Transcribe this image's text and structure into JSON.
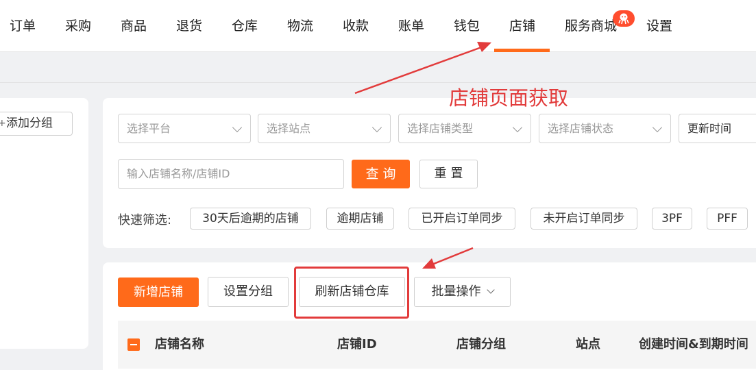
{
  "nav": {
    "items": [
      "订单",
      "采购",
      "商品",
      "退货",
      "仓库",
      "物流",
      "收款",
      "账单",
      "钱包",
      "店铺",
      "服务商城",
      "设置"
    ],
    "active": "店铺",
    "badge_icon": "octopus-icon"
  },
  "sidebar": {
    "add_group": "添加分组",
    "add_icon": "plus-icon"
  },
  "filters": {
    "platform_placeholder": "选择平台",
    "site_placeholder": "选择站点",
    "store_type_placeholder": "选择店铺类型",
    "store_status_placeholder": "选择店铺状态",
    "sort_label": "更新时间",
    "search_placeholder": "输入店铺名称/店铺ID",
    "query_button": "查询",
    "reset_button": "重置",
    "quick_label": "快速筛选:",
    "chips": [
      "30天后逾期的店铺",
      "逾期店铺",
      "已开启订单同步",
      "未开启订单同步",
      "3PF",
      "PFF"
    ]
  },
  "toolbar": {
    "new_store": "新增店铺",
    "set_group": "设置分组",
    "refresh_warehouse": "刷新店铺仓库",
    "batch_ops": "批量操作"
  },
  "table": {
    "headers": [
      "店铺名称",
      "店铺ID",
      "店铺分组",
      "站点",
      "创建时间&到期时间"
    ]
  },
  "annotation": {
    "text": "店铺页面获取",
    "color": "#e23b3b"
  },
  "colors": {
    "accent": "#ff6a1a",
    "annotation": "#e23b3b"
  }
}
